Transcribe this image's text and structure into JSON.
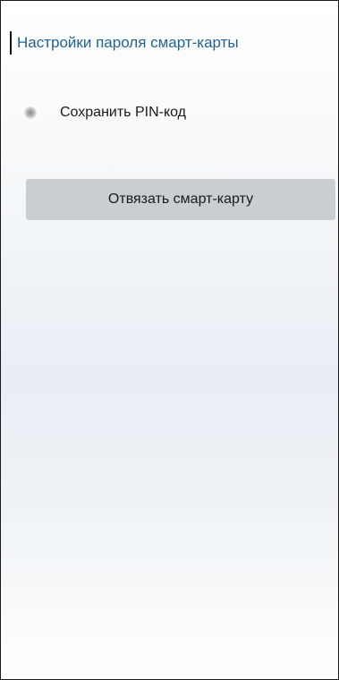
{
  "panel": {
    "title": "Настройки пароля смарт-карты",
    "save_pin": {
      "label": "Сохранить PIN-код",
      "checked": false
    },
    "unbind_button_label": "Отвязать смарт-карту"
  },
  "colors": {
    "title": "#1f6391",
    "button_bg": "#c9ced3",
    "text": "#1a1a1a"
  },
  "icons": {
    "checkbox": "checkbox-indicator-icon"
  }
}
